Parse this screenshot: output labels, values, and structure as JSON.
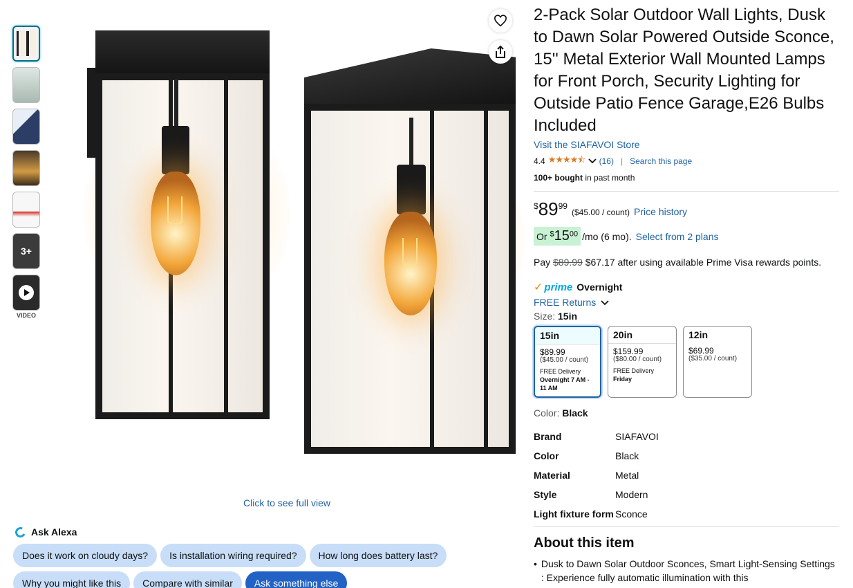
{
  "thumbnails": {
    "more_label": "3+",
    "video_label": "VIDEO"
  },
  "main_image": {
    "full_view_label": "Click to see full view"
  },
  "alexa": {
    "label": "Ask Alexa",
    "chips": [
      "Does it work on cloudy days?",
      "Is installation wiring required?",
      "How long does battery last?",
      "Why you might like this",
      "Compare with similar",
      "Ask something else"
    ]
  },
  "product": {
    "title": "2-Pack Solar Outdoor Wall Lights, Dusk to Dawn Solar Powered Outside Sconce, 15'' Metal Exterior Wall Mounted Lamps for Front Porch, Security Lighting for Outside Patio Fence Garage,E26 Bulbs Included",
    "store_link": "Visit the SIAFAVOI Store",
    "rating": "4.4",
    "stars": "★★★★⯪",
    "review_count": "(16)",
    "search_page": "Search this page",
    "bought_bold": "100+ bought",
    "bought_rest": " in past month"
  },
  "price": {
    "currency": "$",
    "whole": "89",
    "fraction": "99",
    "per_count": "($45.00 / count)",
    "history_link": "Price history",
    "install_or": "Or ",
    "install_currency": "$",
    "install_whole": "15",
    "install_fraction": "00",
    "install_term": "/mo (6 mo).",
    "install_link": "Select from 2 plans",
    "pay_prefix": "Pay ",
    "pay_strike": "$89.99",
    "pay_rest": " $67.17 after using available Prime Visa rewards points."
  },
  "delivery": {
    "prime": "prime",
    "overnight": "Overnight",
    "returns": "FREE Returns"
  },
  "size": {
    "label": "Size: ",
    "selected": "15in",
    "options": [
      {
        "name": "15in",
        "price": "$89.99",
        "count": "($45.00 / count)",
        "delivery": "FREE Delivery",
        "when": "Overnight 7 AM - 11 AM"
      },
      {
        "name": "20in",
        "price": "$159.99",
        "count": "($80.00 / count)",
        "delivery": "FREE Delivery",
        "when": "Friday"
      },
      {
        "name": "12in",
        "price": "$69.99",
        "count": "($35.00 / count)",
        "delivery": "",
        "when": ""
      }
    ]
  },
  "color": {
    "label": "Color: ",
    "value": "Black"
  },
  "specs": [
    {
      "k": "Brand",
      "v": "SIAFAVOI"
    },
    {
      "k": "Color",
      "v": "Black"
    },
    {
      "k": "Material",
      "v": "Metal"
    },
    {
      "k": "Style",
      "v": "Modern"
    },
    {
      "k": "Light fixture form",
      "v": "Sconce"
    }
  ],
  "about": {
    "heading": "About this item",
    "bullet1": "Dusk to Dawn Solar Outdoor Sconces, Smart Light-Sensing Settings : Experience fully automatic illumination with this"
  }
}
